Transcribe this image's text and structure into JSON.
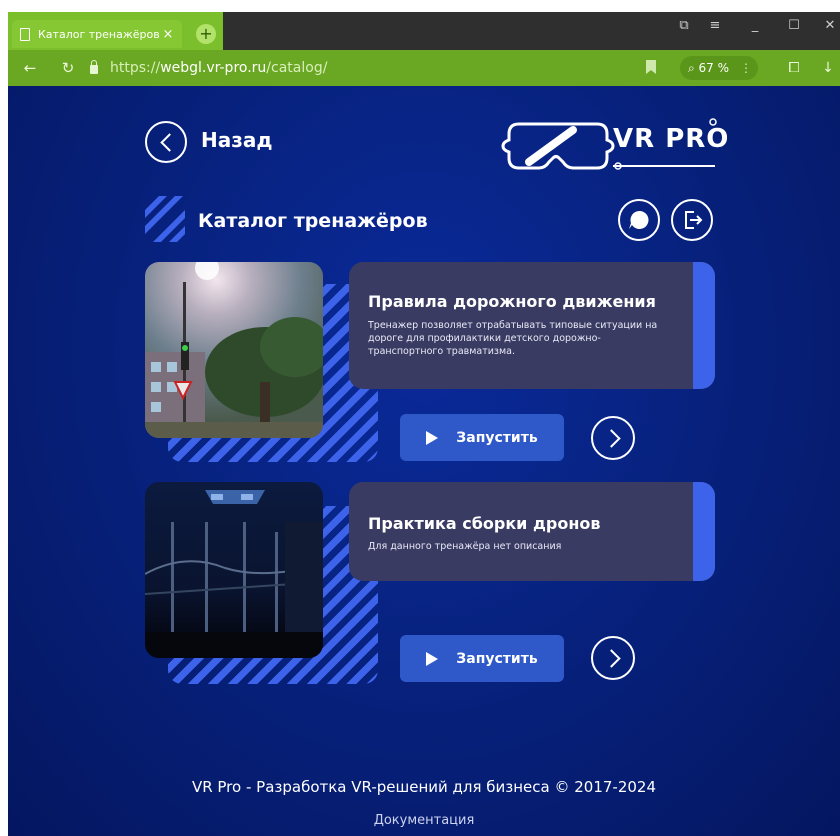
{
  "browser": {
    "tab_title": "Каталог тренажёров - V",
    "tab_close": "×",
    "new_tab": "+",
    "url_scheme": "https://",
    "url_host": "webgl.vr-pro.ru",
    "url_path": "/catalog/",
    "zoom_label": "67 %",
    "zoom_menu": "⋮",
    "window_controls": [
      "⧉",
      "≡",
      "_",
      "☐",
      "✕"
    ]
  },
  "page": {
    "back_label": "Назад",
    "logo_text": "VR PRO",
    "catalog_title": "Каталог тренажёров",
    "launch_label": "Запустить",
    "trainers": [
      {
        "title": "Правила дорожного движения",
        "description": "Тренажер позволяет отрабатывать типовые ситуации на дороге для профилактики детского дорожно-транспортного травматизма."
      },
      {
        "title": "Практика сборки дронов",
        "description": "Для данного тренажёра нет описания"
      }
    ],
    "footer_copy": "VR Pro - Разработка VR-решений для бизнеса © 2017-2024",
    "footer_doc": "Документация"
  },
  "colors": {
    "browser_accent": "#7bc02c",
    "page_bg": "#07227f",
    "stripe_blue": "#3d63ea",
    "panel": "#3a3b63",
    "button": "#2f58c9"
  }
}
